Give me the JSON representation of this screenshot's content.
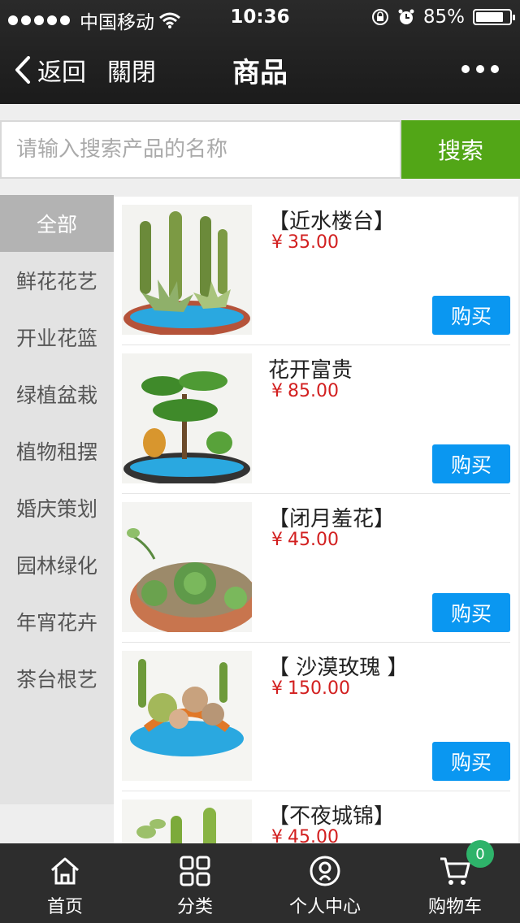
{
  "status_bar": {
    "carrier": "中国移动",
    "time": "10:36",
    "battery_text": "85%",
    "battery_level": 0.85
  },
  "nav": {
    "back_label": "返回",
    "close_label": "關閉",
    "title": "商品"
  },
  "search": {
    "placeholder": "请输入搜索产品的名称",
    "value": "",
    "button_label": "搜索"
  },
  "categories": [
    {
      "label": "全部",
      "active": true
    },
    {
      "label": "鲜花花艺",
      "active": false
    },
    {
      "label": "开业花篮",
      "active": false
    },
    {
      "label": "绿植盆栽",
      "active": false
    },
    {
      "label": "植物租摆",
      "active": false
    },
    {
      "label": "婚庆策划",
      "active": false
    },
    {
      "label": "园林绿化",
      "active": false
    },
    {
      "label": "年宵花卉",
      "active": false
    },
    {
      "label": "茶台根艺",
      "active": false
    }
  ],
  "products": [
    {
      "name": "【近水楼台】",
      "currency": "¥",
      "price": "35.00",
      "buy_label": "购买"
    },
    {
      "name": "花开富贵",
      "currency": "¥",
      "price": "85.00",
      "buy_label": "购买"
    },
    {
      "name": "【闭月羞花】",
      "currency": "¥",
      "price": "45.00",
      "buy_label": "购买"
    },
    {
      "name": "【 沙漠玫瑰 】",
      "currency": "¥",
      "price": "150.00",
      "buy_label": "购买"
    },
    {
      "name": "【不夜城锦】",
      "currency": "¥",
      "price": "45.00",
      "buy_label": "购买"
    }
  ],
  "tabbar": {
    "items": [
      {
        "label": "首页",
        "icon": "home-icon"
      },
      {
        "label": "分类",
        "icon": "grid-icon"
      },
      {
        "label": "个人中心",
        "icon": "user-icon"
      },
      {
        "label": "购物车",
        "icon": "cart-icon"
      }
    ],
    "cart_count": "0"
  },
  "colors": {
    "search_button": "#52a617",
    "buy_button": "#0a97f1",
    "price": "#d21f1f",
    "badge": "#2eb36a"
  }
}
